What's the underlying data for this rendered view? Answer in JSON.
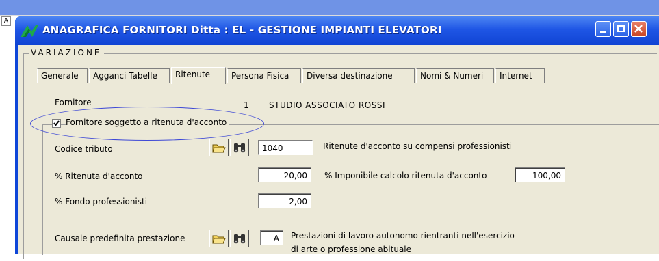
{
  "window": {
    "title": "ANAGRAFICA FORNITORI  Ditta : EL - GESTIONE IMPIANTI ELEVATORI",
    "left_tiny_label": "A"
  },
  "group": {
    "label": "VARIAZIONE"
  },
  "tabs": [
    {
      "label": "Generale"
    },
    {
      "label": "Agganci Tabelle"
    },
    {
      "label": "Ritenute"
    },
    {
      "label": "Persona Fisica"
    },
    {
      "label": "Diversa destinazione"
    },
    {
      "label": "Nomi & Numeri"
    },
    {
      "label": "Internet"
    }
  ],
  "active_tab": "Ritenute",
  "fornitore": {
    "label": "Fornitore",
    "code": "1",
    "name": "STUDIO ASSOCIATO ROSSI"
  },
  "ritenuta_checkbox": {
    "label": "Fornitore soggetto a ritenuta d'acconto",
    "checked": true
  },
  "codice_tributo": {
    "label": "Codice tributo",
    "value": "1040",
    "description": "Ritenute d'acconto su compensi professionisti"
  },
  "ritenuta_acconto": {
    "label": "% Ritenuta d'acconto",
    "value": "20,00"
  },
  "imponibile": {
    "label": "% Imponibile calcolo ritenuta d'acconto",
    "value": "100,00"
  },
  "fondo": {
    "label": "% Fondo professionisti",
    "value": "2,00"
  },
  "causale": {
    "label": "Causale predefinita prestazione",
    "value": "A",
    "description_line1": "Prestazioni di lavoro autonomo rientranti nell'esercizio",
    "description_line2": "di arte o professione abituale"
  },
  "colors": {
    "titlebar": "#1f56e5",
    "client_bg": "#ece9d8",
    "annotation_ellipse": "#3e49d6"
  }
}
